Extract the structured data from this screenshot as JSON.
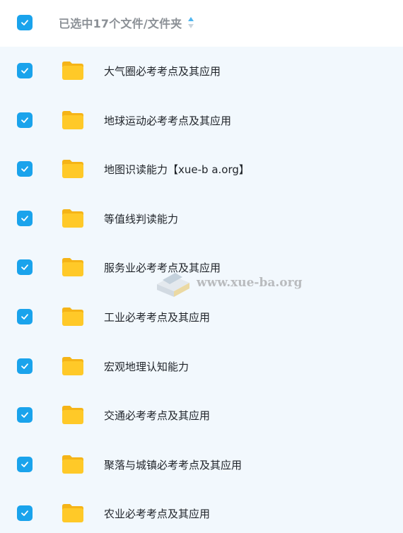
{
  "header": {
    "title": "已选中17个文件/文件夹",
    "checked": true
  },
  "items": [
    {
      "name": "大气圈必考考点及其应用",
      "checked": true,
      "icon": "folder-icon"
    },
    {
      "name": "地球运动必考考点及其应用",
      "checked": true,
      "icon": "folder-icon"
    },
    {
      "name": "地图识读能力【xue-b a.org】",
      "checked": true,
      "icon": "folder-icon"
    },
    {
      "name": "等值线判读能力",
      "checked": true,
      "icon": "folder-icon"
    },
    {
      "name": "服务业必考考点及其应用",
      "checked": true,
      "icon": "folder-icon"
    },
    {
      "name": "工业必考考点及其应用",
      "checked": true,
      "icon": "folder-icon"
    },
    {
      "name": "宏观地理认知能力",
      "checked": true,
      "icon": "folder-icon"
    },
    {
      "name": "交通必考考点及其应用",
      "checked": true,
      "icon": "folder-icon"
    },
    {
      "name": "聚落与城镇必考考点及其应用",
      "checked": true,
      "icon": "folder-icon"
    },
    {
      "name": "农业必考考点及其应用",
      "checked": true,
      "icon": "folder-icon"
    }
  ],
  "watermark": {
    "text": "www.xue-ba.org"
  },
  "colors": {
    "checkbox": "#1aa3ec",
    "list_background": "#f2f8fd",
    "folder": "#ffc928",
    "header_text": "#8b9096",
    "item_text": "#1f2329"
  }
}
